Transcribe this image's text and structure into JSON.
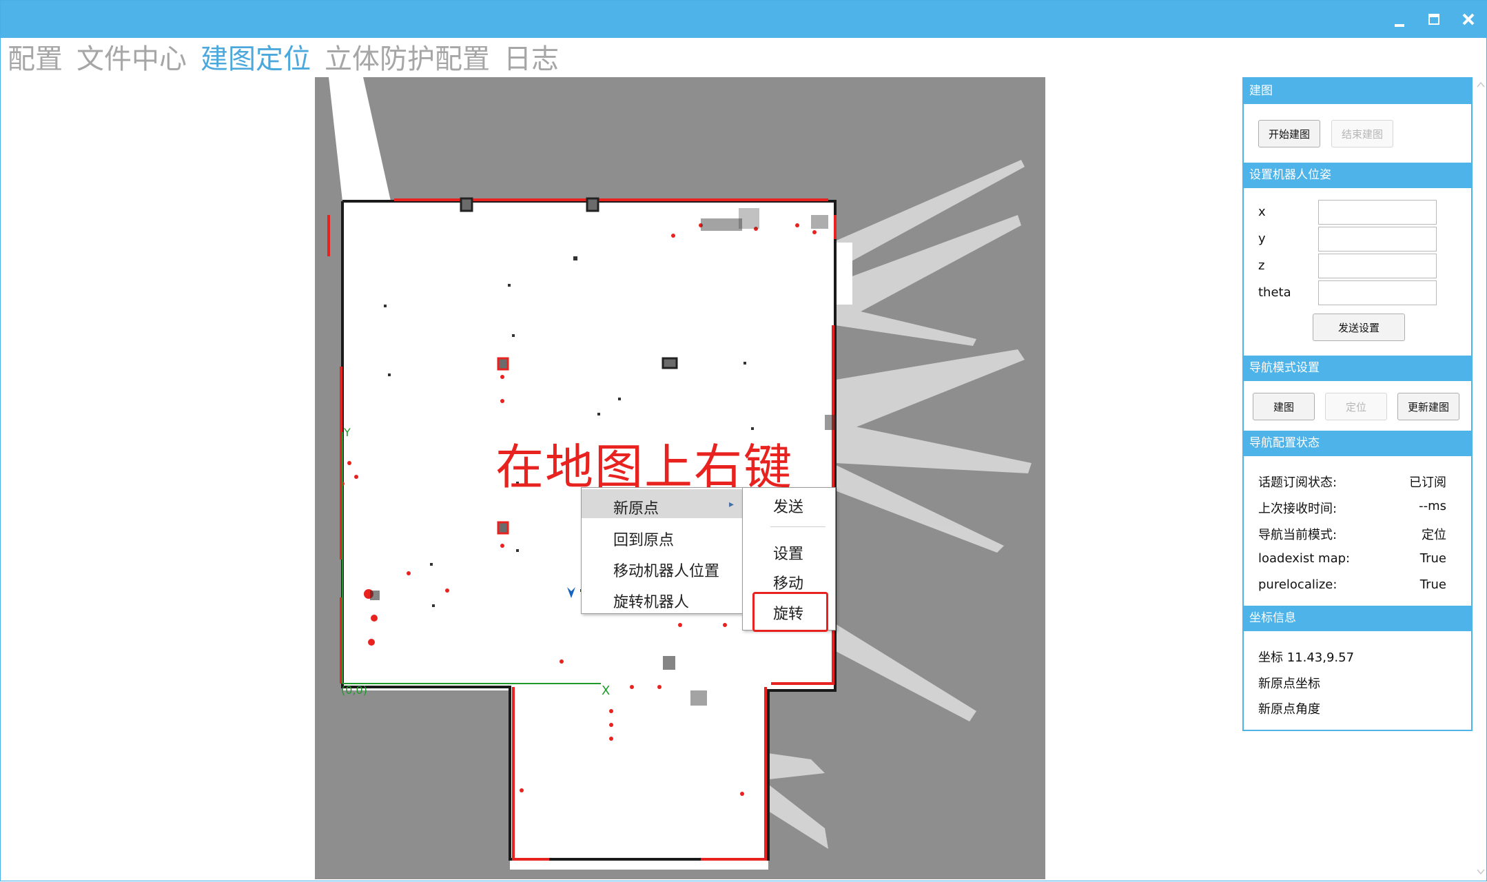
{
  "window": {
    "controls": {
      "minimize_icon": "minimize-icon",
      "maximize_icon": "maximize-icon",
      "close_icon": "close-icon"
    }
  },
  "tabs": [
    {
      "label": "配置"
    },
    {
      "label": "文件中心"
    },
    {
      "label": "建图定位"
    },
    {
      "label": "立体防护配置"
    },
    {
      "label": "日志"
    }
  ],
  "active_tab": "建图定位",
  "map": {
    "annotation": "在地图上右键",
    "origin_label": "(0,0)",
    "axis_x": "X",
    "axis_y": "Y",
    "context_menu": {
      "items": [
        {
          "label": "新原点",
          "has_submenu": true
        },
        {
          "label": "回到原点"
        },
        {
          "label": "移动机器人位置"
        },
        {
          "label": "旋转机器人"
        }
      ],
      "submenu": {
        "items": [
          {
            "label": "发送"
          },
          {
            "label": "设置"
          },
          {
            "label": "移动"
          },
          {
            "label": "旋转"
          }
        ]
      }
    }
  },
  "panel": {
    "mapping": {
      "title": "建图",
      "start_button": "开始建图",
      "end_button": "结束建图"
    },
    "pose": {
      "title": "设置机器人位姿",
      "fields": [
        {
          "label": "x",
          "value": ""
        },
        {
          "label": "y",
          "value": ""
        },
        {
          "label": "z",
          "value": ""
        },
        {
          "label": "theta",
          "value": ""
        }
      ],
      "send_button": "发送设置"
    },
    "nav_mode": {
      "title": "导航模式设置",
      "buttons": [
        {
          "label": "建图",
          "enabled": true
        },
        {
          "label": "定位",
          "enabled": false
        },
        {
          "label": "更新建图",
          "enabled": true
        }
      ]
    },
    "nav_status": {
      "title": "导航配置状态",
      "rows": [
        {
          "label": "话题订阅状态:",
          "value": "已订阅"
        },
        {
          "label": "上次接收时间:",
          "value": "--ms"
        },
        {
          "label": "导航当前模式:",
          "value": "定位"
        },
        {
          "label": "loadexist map:",
          "value": "True"
        },
        {
          "label": "purelocalize:",
          "value": "True"
        }
      ]
    },
    "coords": {
      "title": "坐标信息",
      "coordinate": "坐标 11.43,9.57",
      "new_origin_coord": "新原点坐标",
      "new_origin_angle": "新原点角度"
    }
  },
  "colors": {
    "accent": "#4db3e8",
    "active_tab": "#4aa8dc",
    "inactive_tab": "#a6a6a6",
    "map_unknown": "#8e8e8e",
    "map_free": "#ffffff",
    "map_obstacle": "#e8231f",
    "annotation": "#e8231f"
  }
}
